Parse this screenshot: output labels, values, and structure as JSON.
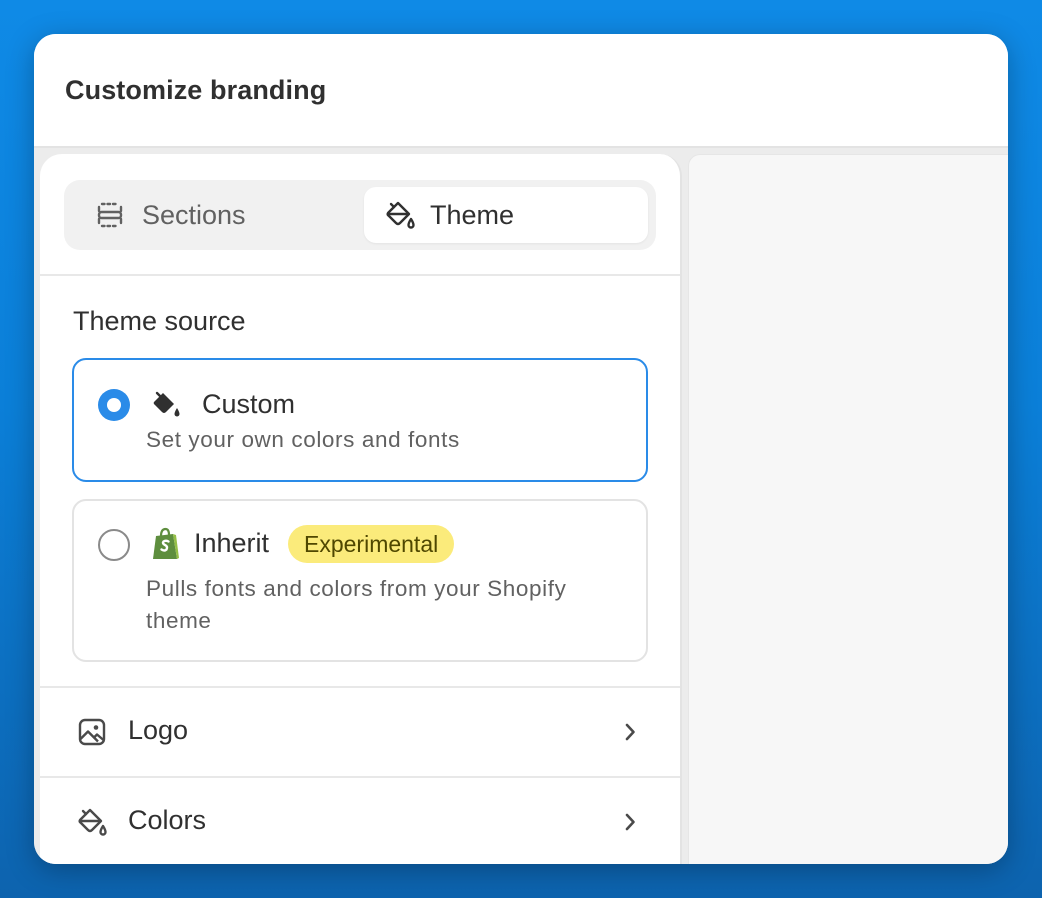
{
  "header": {
    "title": "Customize branding"
  },
  "tabs": [
    {
      "label": "Sections",
      "icon": "sections-icon",
      "selected": false
    },
    {
      "label": "Theme",
      "icon": "paint-bucket-icon",
      "selected": true
    }
  ],
  "theme_source": {
    "label": "Theme source",
    "options": [
      {
        "title": "Custom",
        "description": "Set your own colors and fonts",
        "icon": "paint-bucket-icon",
        "selected": true
      },
      {
        "title": "Inherit",
        "badge": "Experimental",
        "description_line1": "Pulls fonts and colors from your Shopify",
        "description_line2": "theme",
        "icon": "shopify-bag-icon",
        "selected": false
      }
    ]
  },
  "settings_rows": [
    {
      "label": "Logo",
      "icon": "image-icon"
    },
    {
      "label": "Colors",
      "icon": "paint-bucket-icon"
    }
  ],
  "colors": {
    "accent": "#2a8be8",
    "badge_bg": "#fbeb7b",
    "shopify_green": "#5e8e3e"
  }
}
